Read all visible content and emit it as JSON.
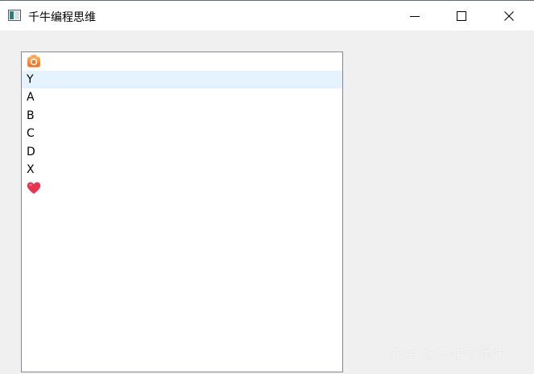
{
  "window": {
    "title": "千牛编程思维",
    "icon": "app-window-icon",
    "controls": {
      "minimize_icon": "minimize-icon",
      "maximize_icon": "maximize-icon",
      "close_icon": "close-icon"
    }
  },
  "list": {
    "items": [
      {
        "type": "icon",
        "icon": "camera-emoji-icon",
        "label": ""
      },
      {
        "type": "text",
        "label": "Y",
        "selected": true
      },
      {
        "type": "text",
        "label": "A"
      },
      {
        "type": "text",
        "label": "B"
      },
      {
        "type": "text",
        "label": "C"
      },
      {
        "type": "text",
        "label": "D"
      },
      {
        "type": "text",
        "label": "X"
      },
      {
        "type": "icon",
        "icon": "heart-emoji-icon",
        "label": ""
      }
    ]
  },
  "watermark": {
    "text": "知乎 @千牛不是牛"
  },
  "colors": {
    "selection": "#e5f3ff",
    "border": "#828790",
    "background": "#f0f0f0"
  }
}
